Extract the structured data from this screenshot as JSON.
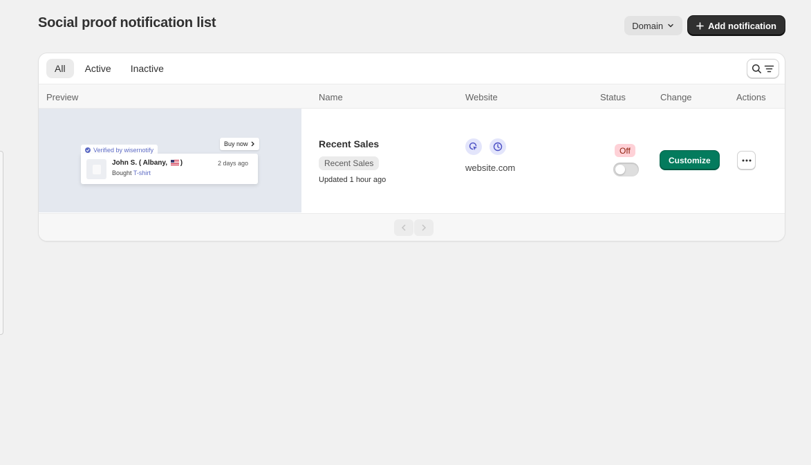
{
  "header": {
    "title": "Social proof notification list",
    "domain_label": "Domain",
    "add_label": "Add notification"
  },
  "tabs": [
    {
      "label": "All",
      "active": true
    },
    {
      "label": "Active",
      "active": false
    },
    {
      "label": "Inactive",
      "active": false
    }
  ],
  "table": {
    "columns": [
      "Preview",
      "Name",
      "Website",
      "Status",
      "Change",
      "Actions"
    ],
    "rows": [
      {
        "preview": {
          "verified": "Verified by wisernotify",
          "buy_now": "Buy now",
          "name_line": "John S. ( Albany,",
          "name_suffix": ")",
          "time": "2 days ago",
          "bought_prefix": "Bought",
          "product": "T-shirt"
        },
        "name": "Recent Sales",
        "type_badge": "Recent Sales",
        "updated": "Updated 1 hour ago",
        "website_icons": [
          "cursor-click-icon",
          "clock-icon"
        ],
        "website": "website.com",
        "status": "Off",
        "toggle_on": false,
        "change_label": "Customize"
      }
    ]
  },
  "colors": {
    "primary_dark": "#303030",
    "customize_green": "#047b5d",
    "status_off_bg": "#fed1d7",
    "accent_purple": "#5c6ac4"
  }
}
